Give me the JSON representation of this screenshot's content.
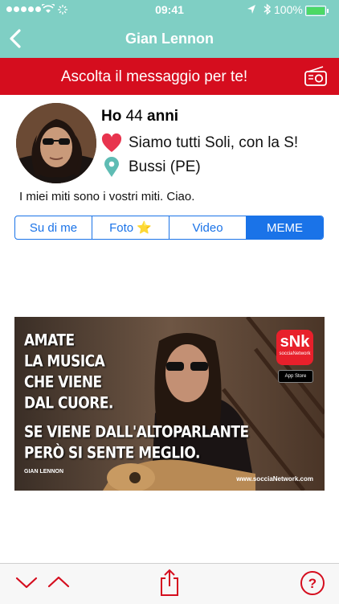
{
  "status_bar": {
    "time": "09:41",
    "battery": "100%",
    "battery_level": 1.0
  },
  "nav": {
    "title": "Gian Lennon",
    "back_icon": "chevron-left-icon"
  },
  "banner": {
    "text": "Ascolta il messaggio per te!",
    "icon": "radio-icon"
  },
  "profile": {
    "age_prefix": "Ho",
    "age_value": "44",
    "age_suffix": "anni",
    "motto": "Siamo tutti Soli, con la S!",
    "location": "Bussi (PE)",
    "bio": "I miei miti sono i vostri miti. Ciao."
  },
  "tabs": [
    {
      "label": "Su di me",
      "active": false
    },
    {
      "label": "Foto ⭐",
      "active": false
    },
    {
      "label": "Video",
      "active": false
    },
    {
      "label": "MEME",
      "active": true
    }
  ],
  "meme": {
    "lines": [
      "AMATE",
      "LA MUSICA",
      "CHE VIENE",
      "DAL CUORE.",
      "SE VIENE DALL'ALTOPARLANTE",
      "PERÒ SI SENTE MEGLIO."
    ],
    "signature": "GIAN LENNON",
    "logo": "sNk",
    "logo_sub": "socciaNetwork",
    "badge": "App Store",
    "url": "www.socciaNetwork.com"
  },
  "colors": {
    "header": "#7fcfc4",
    "banner": "#d50d1e",
    "accent": "#1a73e8",
    "toolbar_icons": "#d50d1e"
  }
}
